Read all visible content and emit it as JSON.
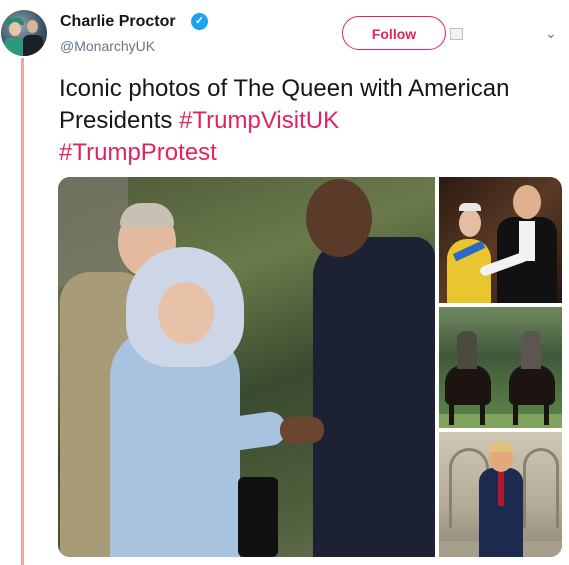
{
  "author": {
    "name": "Charlie Proctor",
    "handle": "@MonarchyUK",
    "verified_glyph": "✓"
  },
  "header": {
    "follow_label": "Follow",
    "caret_glyph": "⌄"
  },
  "tweet": {
    "text": "Iconic photos of The Queen with American Presidents",
    "hashtags": [
      "#TrumpVisitUK",
      "#TrumpProtest"
    ]
  },
  "media": {
    "photo_count": 4
  },
  "colors": {
    "accent": "#e0245e",
    "thread_line": "#f4a3a8",
    "verified": "#1da1f2",
    "handle_gray": "#657786"
  }
}
